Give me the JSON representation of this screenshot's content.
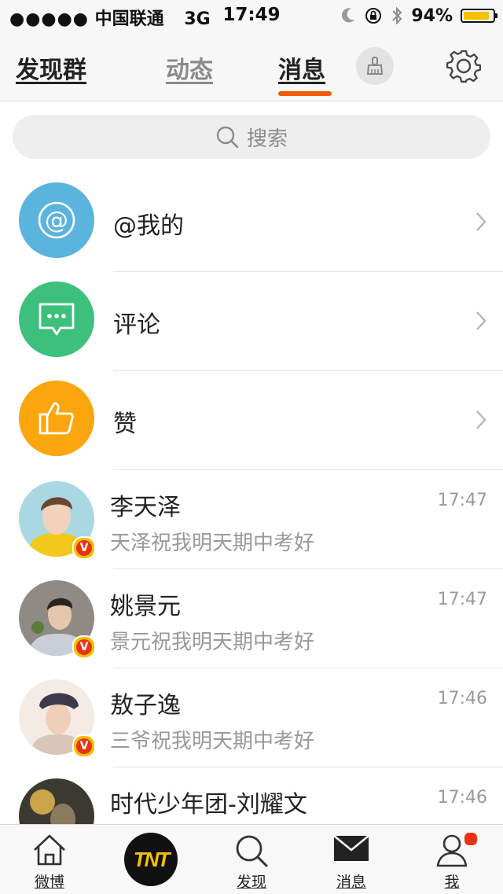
{
  "status_bar": {
    "signal": "●●●●●",
    "carrier": "中国联通",
    "network": "3G",
    "time": "17:49",
    "battery_percent": "94%",
    "battery_level": 0.94,
    "icons": [
      "moon-icon",
      "rotation-lock-icon",
      "bluetooth-icon",
      "battery-icon"
    ]
  },
  "nav": {
    "tabs": [
      {
        "label": "发现群",
        "active": false
      },
      {
        "label": "动态",
        "active": false
      },
      {
        "label": "消息",
        "active": true
      }
    ],
    "accent_color": "#f25a0a",
    "icons": [
      "broom-icon",
      "gear-icon"
    ]
  },
  "search": {
    "placeholder": "搜索"
  },
  "categories": [
    {
      "label": "@我的",
      "color": "#5ab4dd",
      "icon": "at-icon"
    },
    {
      "label": "评论",
      "color": "#3cc07c",
      "icon": "comment-icon"
    },
    {
      "label": "赞",
      "color": "#fba60e",
      "icon": "thumbs-up-icon"
    }
  ],
  "messages": [
    {
      "name": "李天泽",
      "preview": "天泽祝我明天期中考好",
      "time": "17:47",
      "badge": "V"
    },
    {
      "name": "姚景元",
      "preview": "景元祝我明天期中考好",
      "time": "17:47",
      "badge": "V"
    },
    {
      "name": "敖子逸",
      "preview": "三爷祝我明天期中考好",
      "time": "17:46",
      "badge": "V"
    },
    {
      "name": "时代少年团-刘耀文",
      "preview": "",
      "time": "17:46",
      "badge": ""
    }
  ],
  "tabbar": {
    "items": [
      {
        "label": "微博",
        "icon": "home-icon"
      },
      {
        "label": "",
        "icon": "tnt-logo"
      },
      {
        "label": "发现",
        "icon": "search-icon"
      },
      {
        "label": "消息",
        "icon": "mail-icon"
      },
      {
        "label": "我",
        "icon": "profile-icon",
        "has_notification": true
      }
    ],
    "logo_text": "TNT"
  }
}
